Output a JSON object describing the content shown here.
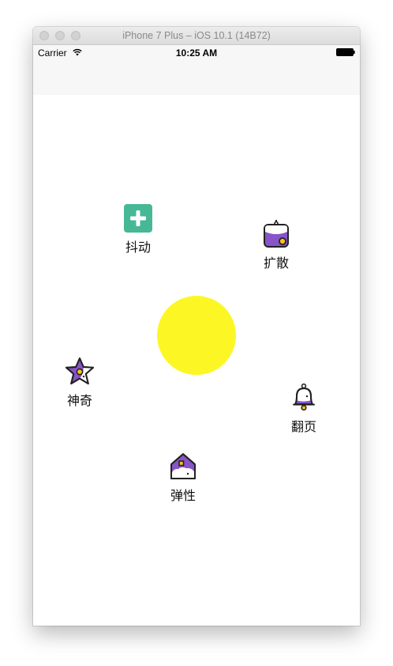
{
  "window": {
    "title": "iPhone 7 Plus – iOS 10.1 (14B72)"
  },
  "status_bar": {
    "carrier": "Carrier",
    "time": "10:25 AM"
  },
  "center": {
    "color": "#fcf724"
  },
  "menu_items": [
    {
      "label": "抖动",
      "icon": "plus-square-icon",
      "color": "#47b895"
    },
    {
      "label": "扩散",
      "icon": "wallet-icon",
      "color": "#8854c8"
    },
    {
      "label": "神奇",
      "icon": "star-icon",
      "color": "#8854c8"
    },
    {
      "label": "翻页",
      "icon": "bell-icon",
      "color": "#8854c8"
    },
    {
      "label": "弹性",
      "icon": "house-icon",
      "color": "#8854c8"
    }
  ]
}
